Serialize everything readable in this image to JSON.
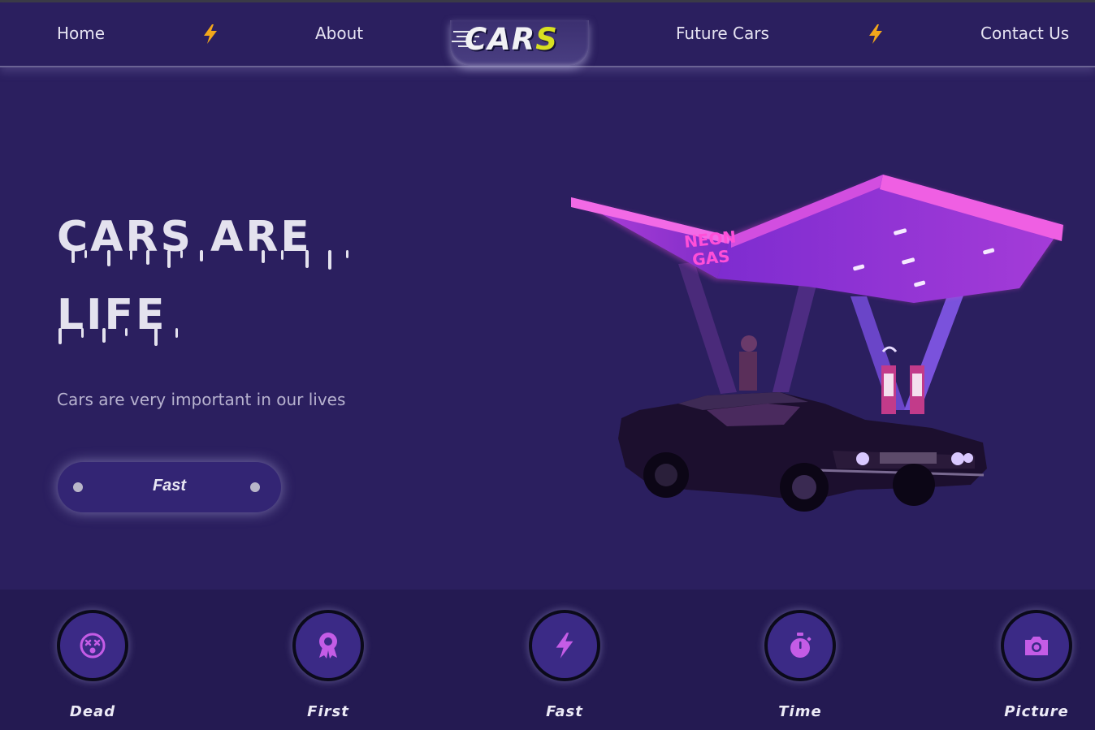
{
  "nav": {
    "links": [
      "Home",
      "About",
      "Future Cars",
      "Contact Us"
    ],
    "logo_text_main": "CAR",
    "logo_text_accent": "S"
  },
  "hero": {
    "title_line1": "CARS ARE",
    "title_line2": "LIFE",
    "subtitle": "Cars are very important in our lives",
    "button_label": "Fast"
  },
  "features": [
    {
      "label": "Dead",
      "icon": "dizzy-face-icon"
    },
    {
      "label": "First",
      "icon": "award-ribbon-icon"
    },
    {
      "label": "Fast",
      "icon": "lightning-bolt-icon"
    },
    {
      "label": "Time",
      "icon": "stopwatch-icon"
    },
    {
      "label": "Picture",
      "icon": "camera-icon"
    }
  ],
  "scene": {
    "sign_text_line1": "NEON",
    "sign_text_line2": "GAS",
    "alt": "neon gas station with muscle car"
  },
  "colors": {
    "background": "#2b1f5f",
    "strip": "#241a52",
    "bolt": "#f2a71b",
    "icon": "#c45ce6",
    "neon_pink": "#e64bd8",
    "logo_accent": "#d8e021"
  }
}
